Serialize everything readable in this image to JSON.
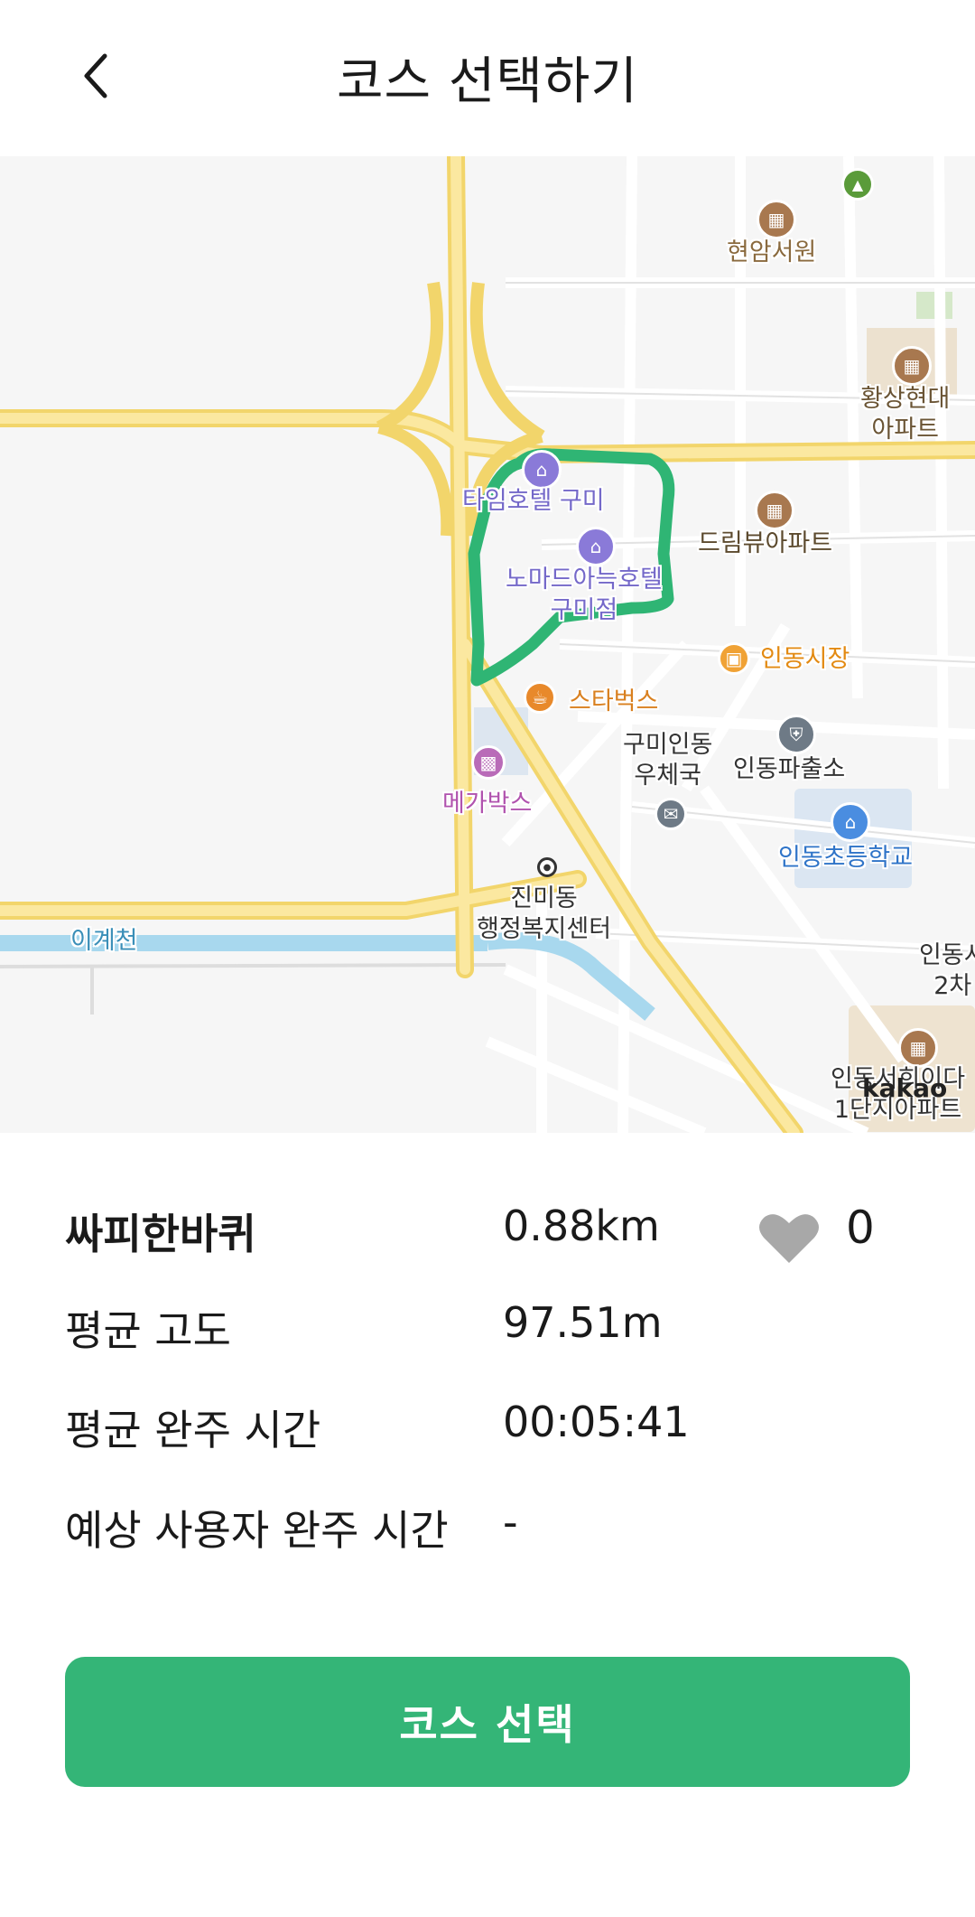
{
  "header": {
    "title": "코스 선택하기"
  },
  "map": {
    "watermark": "kakao",
    "pois": {
      "hyunam": "현암서원",
      "hwangsang": "황상현대\n아파트",
      "timehotel": "타임호텔 구미",
      "dreamview": "드림뷰아파트",
      "nomad": "노마드아늑호텔\n구미점",
      "market": "인동시장",
      "starbucks": "스타벅스",
      "postoffice": "구미인동\n우체국",
      "police": "인동파출소",
      "megabox": "메가박스",
      "school": "인동초등학교",
      "jinmi": "진미동\n행정복지센터",
      "stream": "이계천",
      "indong_edge": "인동시\n2차",
      "apt_bottom": "인동서희이다\n1단지아파트"
    },
    "route_color": "#2fb574"
  },
  "course": {
    "name": "싸피한바퀴",
    "distance": "0.88km",
    "likes": "0"
  },
  "stats": {
    "altitude_label": "평균 고도",
    "altitude_value": "97.51m",
    "avg_time_label": "평균 완주 시간",
    "avg_time_value": "00:05:41",
    "expected_label": "예상 사용자 완주 시간",
    "expected_value": "-"
  },
  "actions": {
    "select_label": "코스 선택"
  }
}
